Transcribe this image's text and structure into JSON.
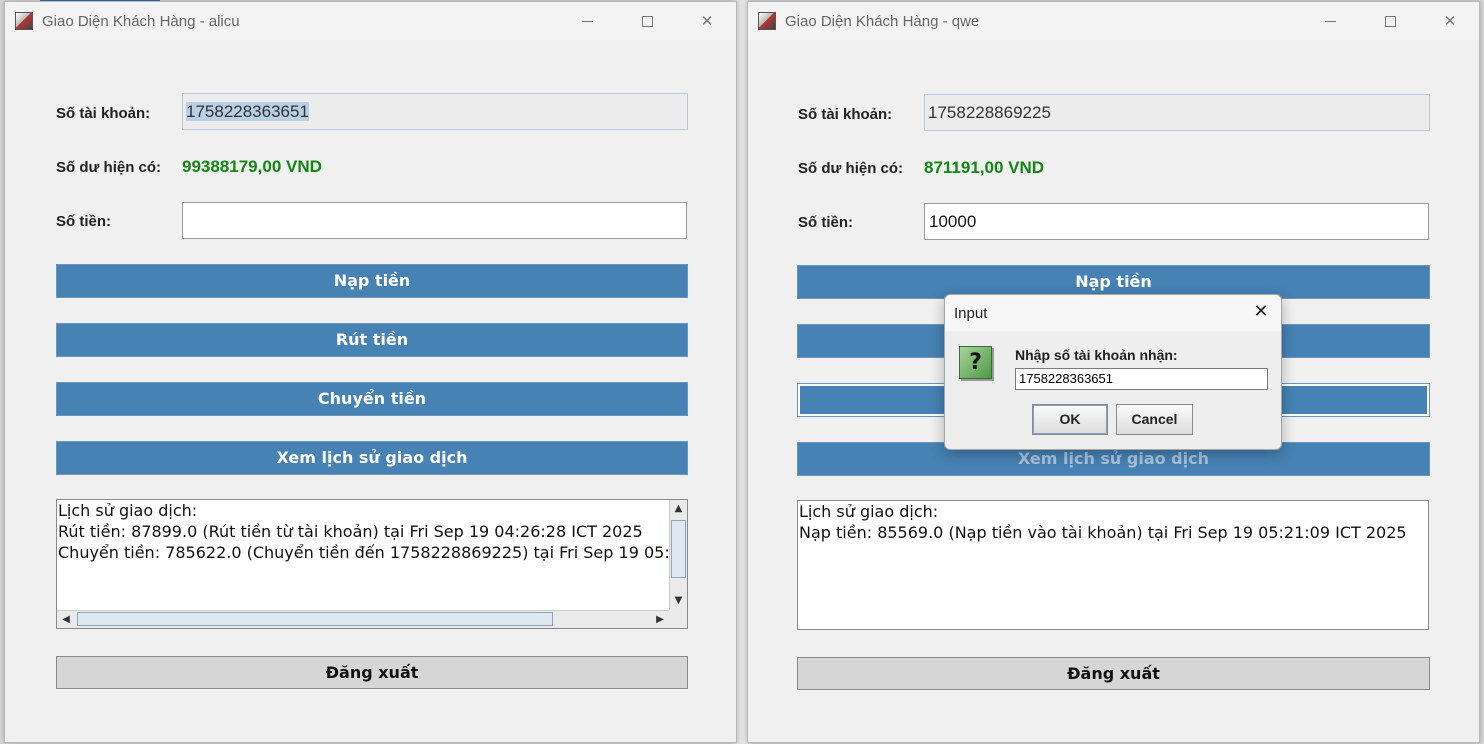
{
  "windows": [
    {
      "title": "Giao Diện Khách Hàng - alicu",
      "account_label": "Số tài khoản:",
      "account_number": "1758228363651",
      "balance_label": "Số dư hiện có:",
      "balance": "99388179,00 VND",
      "amount_label": "Số tiền:",
      "amount_value": "",
      "buttons": {
        "deposit": "Nạp tiền",
        "withdraw": "Rút tiền",
        "transfer": "Chuyển tiền",
        "history": "Xem lịch sử giao dịch",
        "logout": "Đăng xuất"
      },
      "history_lines": [
        "Lịch sử giao dịch:",
        "Rút tiền: 87899.0 (Rút tiền từ tài khoản) tại Fri Sep 19 04:26:28 ICT 2025",
        "Chuyển tiền: 785622.0 (Chuyển tiền đến 1758228869225) tại Fri Sep 19 05:2"
      ]
    },
    {
      "title": "Giao Diện Khách Hàng - qwe",
      "account_label": "Số tài khoản:",
      "account_number": "1758228869225",
      "balance_label": "Số dư hiện có:",
      "balance": "871191,00 VND",
      "amount_label": "Số tiền:",
      "amount_value": "10000",
      "buttons": {
        "deposit": "Nạp tiền",
        "withdraw": "",
        "transfer": "",
        "history": "Xem lịch sử giao dịch",
        "logout": "Đăng xuất"
      },
      "history_lines": [
        "Lịch sử giao dịch:",
        "Nạp tiền: 85569.0 (Nạp tiền vào tài khoản) tại Fri Sep 19 05:21:09 ICT 2025"
      ]
    }
  ],
  "dialog": {
    "title": "Input",
    "prompt": "Nhập số tài khoản nhận:",
    "input_value": "1758228363651",
    "ok_label": "OK",
    "cancel_label": "Cancel",
    "icon": "question-icon"
  },
  "colors": {
    "button_blue": "#4682b4",
    "balance_green": "#138713"
  }
}
